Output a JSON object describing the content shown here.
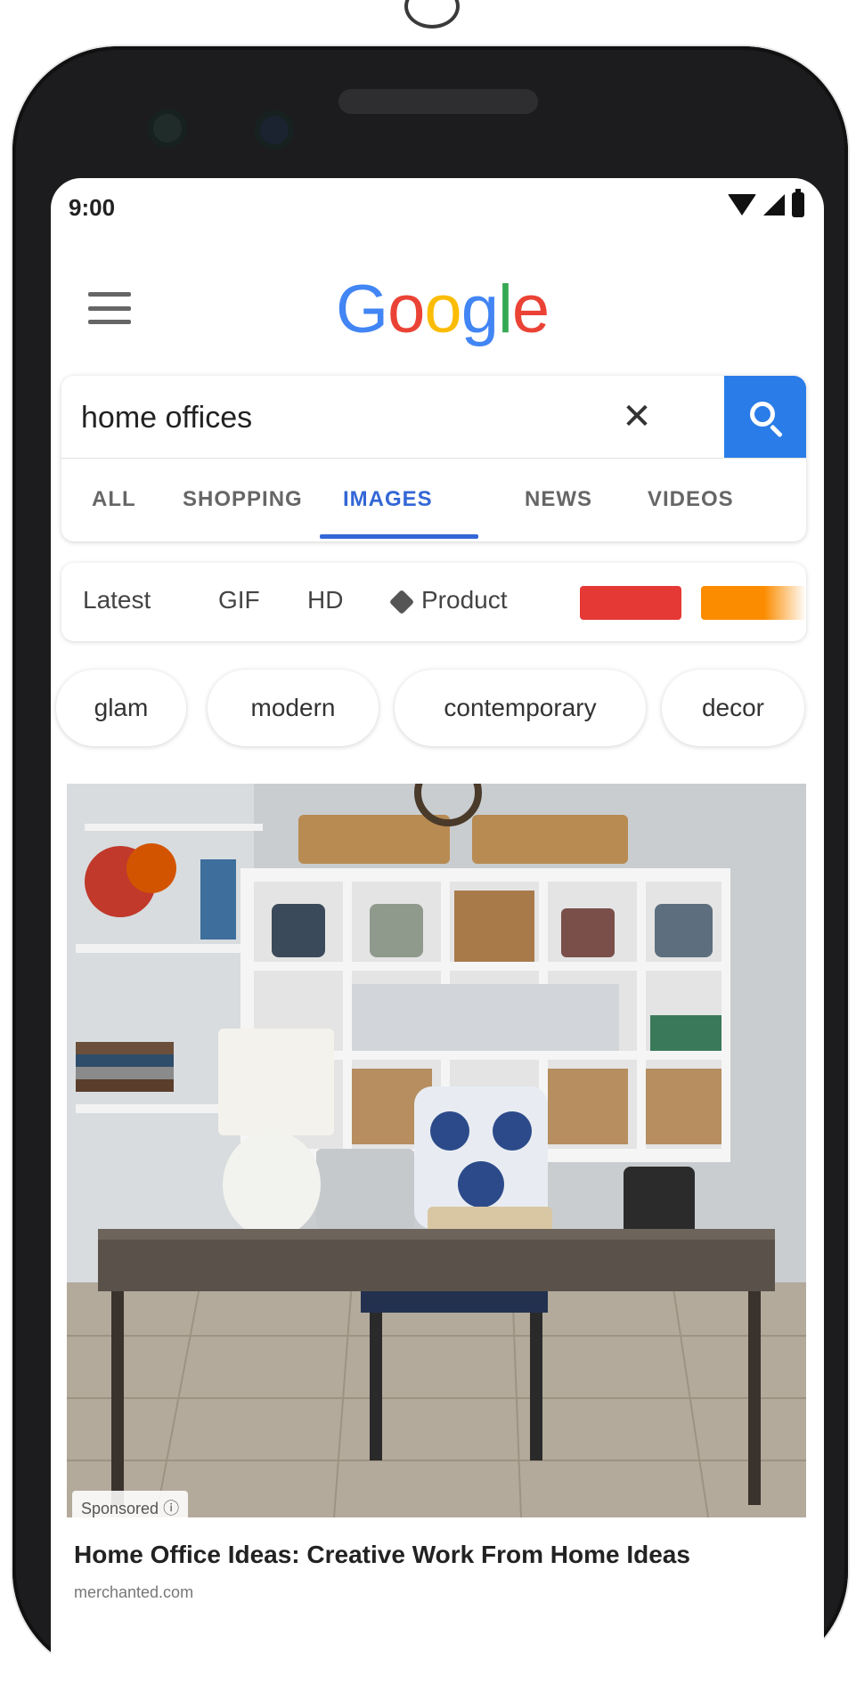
{
  "status_bar": {
    "time": "9:00"
  },
  "logo": {
    "letters": [
      "G",
      "o",
      "o",
      "g",
      "l",
      "e"
    ],
    "colors": [
      "#4285f4",
      "#ea4335",
      "#fbbc05",
      "#4285f4",
      "#34a853",
      "#ea4335"
    ]
  },
  "search": {
    "query": "home offices"
  },
  "tabs": [
    {
      "label": "ALL",
      "active": false
    },
    {
      "label": "SHOPPING",
      "active": false
    },
    {
      "label": "IMAGES",
      "active": true
    },
    {
      "label": "NEWS",
      "active": false
    },
    {
      "label": "VIDEOS",
      "active": false
    }
  ],
  "filters": {
    "latest": "Latest",
    "gif": "GIF",
    "hd": "HD",
    "product": "Product",
    "swatch_colors": [
      "#e53935",
      "#fb8c00"
    ]
  },
  "chips": [
    "glam",
    "modern",
    "contemporary",
    "decor"
  ],
  "result": {
    "sponsored": "Sponsored ⓘ",
    "title": "Home Office Ideas: Creative Work From Home Ideas",
    "source": "merchanted.com"
  },
  "colors": {
    "accent": "#3367d6",
    "search_button": "#2a7ce8"
  }
}
